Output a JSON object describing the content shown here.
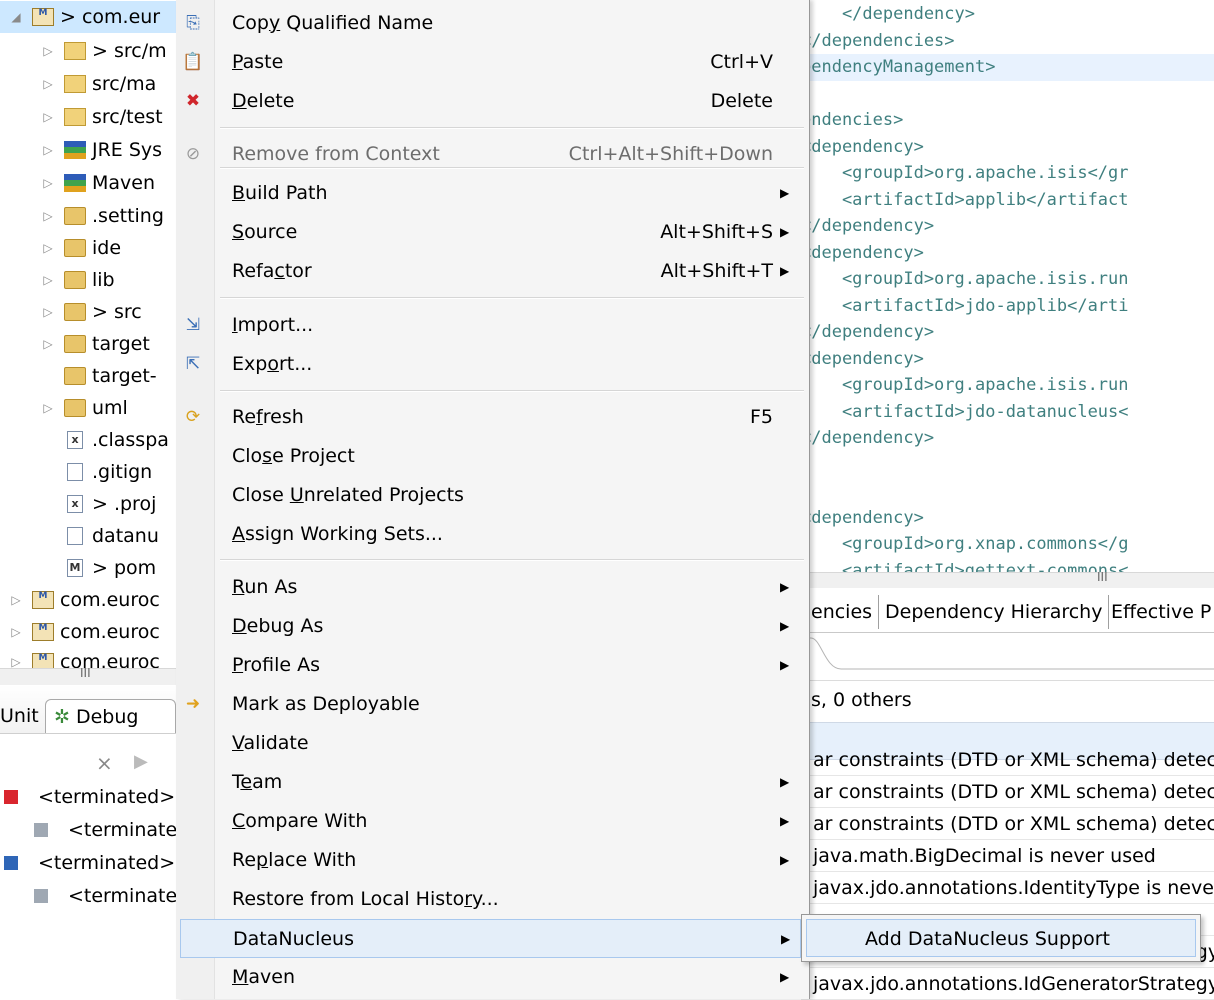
{
  "tree": {
    "items": [
      {
        "arrow": "◢",
        "label": "> com.eur",
        "icon": "maven-project-icon"
      },
      {
        "arrow": "▷",
        "label": "> src/m",
        "icon": "source-folder-icon"
      },
      {
        "arrow": "▷",
        "label": "src/ma",
        "icon": "source-folder-icon"
      },
      {
        "arrow": "▷",
        "label": "src/test",
        "icon": "source-folder-icon"
      },
      {
        "arrow": "▷",
        "label": "JRE Sys",
        "icon": "library-icon"
      },
      {
        "arrow": "▷",
        "label": "Maven",
        "icon": "library-icon"
      },
      {
        "arrow": "▷",
        "label": ".setting",
        "icon": "folder-icon"
      },
      {
        "arrow": "▷",
        "label": "ide",
        "icon": "folder-icon"
      },
      {
        "arrow": "▷",
        "label": "lib",
        "icon": "folder-icon"
      },
      {
        "arrow": "▷",
        "label": "> src",
        "icon": "folder-icon"
      },
      {
        "arrow": "▷",
        "label": "target",
        "icon": "folder-icon"
      },
      {
        "arrow": "",
        "label": "target-",
        "icon": "folder-icon"
      },
      {
        "arrow": "▷",
        "label": "uml",
        "icon": "folder-icon"
      },
      {
        "arrow": "",
        "label": ".classpa",
        "icon": "xml-file-icon"
      },
      {
        "arrow": "",
        "label": ".gitign",
        "icon": "text-file-icon"
      },
      {
        "arrow": "",
        "label": "> .proj",
        "icon": "xml-file-icon"
      },
      {
        "arrow": "",
        "label": "datanu",
        "icon": "text-file-icon"
      },
      {
        "arrow": "",
        "label": "> pom",
        "icon": "pom-file-icon"
      },
      {
        "arrow": "▷",
        "label": "com.euroc",
        "icon": "maven-project-icon"
      },
      {
        "arrow": "▷",
        "label": "com.euroc",
        "icon": "maven-project-icon"
      },
      {
        "arrow": "▷",
        "label": "com.euroc",
        "icon": "maven-project-icon"
      }
    ],
    "scroll_grip": "III"
  },
  "debug": {
    "tab_junit": "Unit",
    "tab_debug": "Debug",
    "rows": [
      {
        "label": "<terminated>",
        "icon": "terminated-icon"
      },
      {
        "label": "<terminate",
        "icon": "process-icon"
      },
      {
        "label": "<terminated>",
        "icon": "junit-icon"
      },
      {
        "label": "<terminate",
        "icon": "process-icon"
      }
    ]
  },
  "editor": {
    "lines": [
      "    </dependency>",
      "</dependencies>",
      "pendencyManagement>",
      "",
      "endencies>",
      "<dependency>",
      "    <groupId>org.apache.isis</gr",
      "    <artifactId>applib</artifact",
      "</dependency>",
      "<dependency>",
      "    <groupId>org.apache.isis.run",
      "    <artifactId>jdo-applib</arti",
      "</dependency>",
      "<dependency>",
      "    <groupId>org.apache.isis.run",
      "    <artifactId>jdo-datanucleus<",
      "</dependency>",
      "",
      "",
      "<dependency>",
      "    <groupId>org.xnap.commons</g",
      "    <artifactId>gettext-commons<"
    ],
    "scroll_grip": "III"
  },
  "pom_tabs": [
    "encies",
    "Dependency Hierarchy",
    "Effective P"
  ],
  "problems": {
    "summary": "s, 0 others",
    "rows": [
      "ar constraints (DTD or XML schema) detect",
      "ar constraints (DTD or XML schema) detect",
      "ar constraints (DTD or XML schema) detect",
      "java.math.BigDecimal is never used",
      "javax.jdo.annotations.IdentityType is neve",
      "",
      "javax.jdo.annotations.IdGeneratorStrategy",
      "javax.jdo.annotations.IdGeneratorStrategy"
    ]
  },
  "menu": {
    "items": [
      {
        "label": "Copy Qualified Name",
        "shortcut": "",
        "submenu": false,
        "icon": "copy-icon"
      },
      {
        "label": "Paste",
        "shortcut": "Ctrl+V",
        "submenu": false,
        "icon": "paste-icon"
      },
      {
        "label": "Delete",
        "shortcut": "Delete",
        "submenu": false,
        "icon": "delete-icon"
      },
      {
        "label": "Remove from Context",
        "shortcut": "Ctrl+Alt+Shift+Down",
        "submenu": false,
        "icon": "remove-context-icon",
        "disabled": true
      },
      {
        "label": "Build Path",
        "shortcut": "",
        "submenu": true
      },
      {
        "label": "Source",
        "shortcut": "Alt+Shift+S",
        "submenu": true
      },
      {
        "label": "Refactor",
        "shortcut": "Alt+Shift+T",
        "submenu": true
      },
      {
        "label": "Import...",
        "shortcut": "",
        "submenu": false,
        "icon": "import-icon"
      },
      {
        "label": "Export...",
        "shortcut": "",
        "submenu": false,
        "icon": "export-icon"
      },
      {
        "label": "Refresh",
        "shortcut": "F5",
        "submenu": false,
        "icon": "refresh-icon"
      },
      {
        "label": "Close Project",
        "shortcut": "",
        "submenu": false
      },
      {
        "label": "Close Unrelated Projects",
        "shortcut": "",
        "submenu": false
      },
      {
        "label": "Assign Working Sets...",
        "shortcut": "",
        "submenu": false
      },
      {
        "label": "Run As",
        "shortcut": "",
        "submenu": true
      },
      {
        "label": "Debug As",
        "shortcut": "",
        "submenu": true
      },
      {
        "label": "Profile As",
        "shortcut": "",
        "submenu": true
      },
      {
        "label": "Mark as Deployable",
        "shortcut": "",
        "submenu": false,
        "icon": "deployable-icon"
      },
      {
        "label": "Validate",
        "shortcut": "",
        "submenu": false
      },
      {
        "label": "Team",
        "shortcut": "",
        "submenu": true
      },
      {
        "label": "Compare With",
        "shortcut": "",
        "submenu": true
      },
      {
        "label": "Replace With",
        "shortcut": "",
        "submenu": true
      },
      {
        "label": "Restore from Local History...",
        "shortcut": "",
        "submenu": false
      },
      {
        "label": "DataNucleus",
        "shortcut": "",
        "submenu": true,
        "active": true
      },
      {
        "label": "Maven",
        "shortcut": "",
        "submenu": true
      }
    ],
    "submenu_arrow": "▶"
  },
  "submenu": {
    "item": "Add DataNucleus Support"
  },
  "colors": {
    "menu_bg": "#f5f5f5",
    "highlight": "#e4eef9",
    "highlight_border": "#a8c8ee",
    "xml_tag": "#3f7f7f"
  }
}
